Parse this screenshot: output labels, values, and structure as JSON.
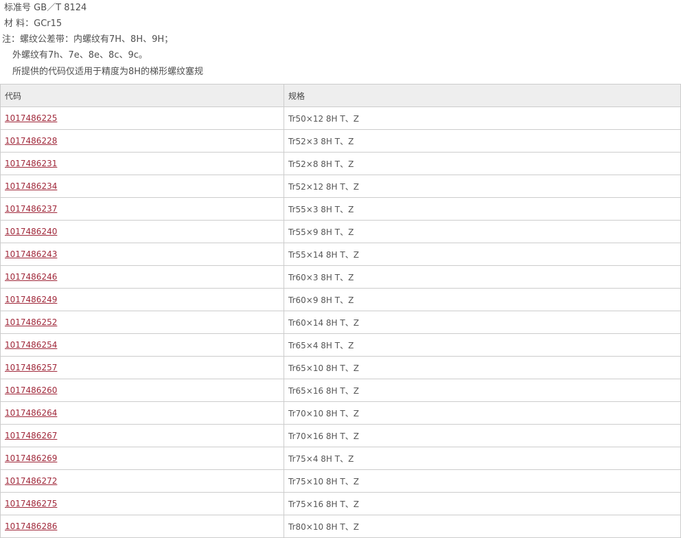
{
  "header": {
    "standard": "标准号 GB／T 8124",
    "material": "材 料：GCr15",
    "note1": "注：螺纹公差带：内螺纹有7H、8H、9H；",
    "note2": "外螺纹有7h、7e、8e、8c、9c。",
    "note3": "所提供的代码仅适用于精度为8H的梯形螺纹塞规"
  },
  "table": {
    "col_code": "代码",
    "col_spec": "规格",
    "rows": [
      {
        "code": "1017486225",
        "spec": "Tr50×12 8H T、Z"
      },
      {
        "code": "1017486228",
        "spec": "Tr52×3 8H T、Z"
      },
      {
        "code": "1017486231",
        "spec": "Tr52×8 8H T、Z"
      },
      {
        "code": "1017486234",
        "spec": "Tr52×12 8H T、Z"
      },
      {
        "code": "1017486237",
        "spec": "Tr55×3 8H T、Z"
      },
      {
        "code": "1017486240",
        "spec": "Tr55×9 8H T、Z"
      },
      {
        "code": "1017486243",
        "spec": "Tr55×14 8H T、Z"
      },
      {
        "code": "1017486246",
        "spec": "Tr60×3 8H T、Z"
      },
      {
        "code": "1017486249",
        "spec": "Tr60×9 8H T、Z"
      },
      {
        "code": "1017486252",
        "spec": "Tr60×14 8H T、Z"
      },
      {
        "code": "1017486254",
        "spec": "Tr65×4 8H T、Z"
      },
      {
        "code": "1017486257",
        "spec": "Tr65×10 8H T、Z"
      },
      {
        "code": "1017486260",
        "spec": "Tr65×16 8H T、Z"
      },
      {
        "code": "1017486264",
        "spec": "Tr70×10 8H T、Z"
      },
      {
        "code": "1017486267",
        "spec": "Tr70×16 8H T、Z"
      },
      {
        "code": "1017486269",
        "spec": "Tr75×4 8H T、Z"
      },
      {
        "code": "1017486272",
        "spec": "Tr75×10 8H T、Z"
      },
      {
        "code": "1017486275",
        "spec": "Tr75×16 8H T、Z"
      },
      {
        "code": "1017486286",
        "spec": "Tr80×10 8H T、Z"
      }
    ]
  },
  "colors": {
    "link": "#a0283a",
    "header_bg": "#eeeeee",
    "border": "#cccccc"
  }
}
